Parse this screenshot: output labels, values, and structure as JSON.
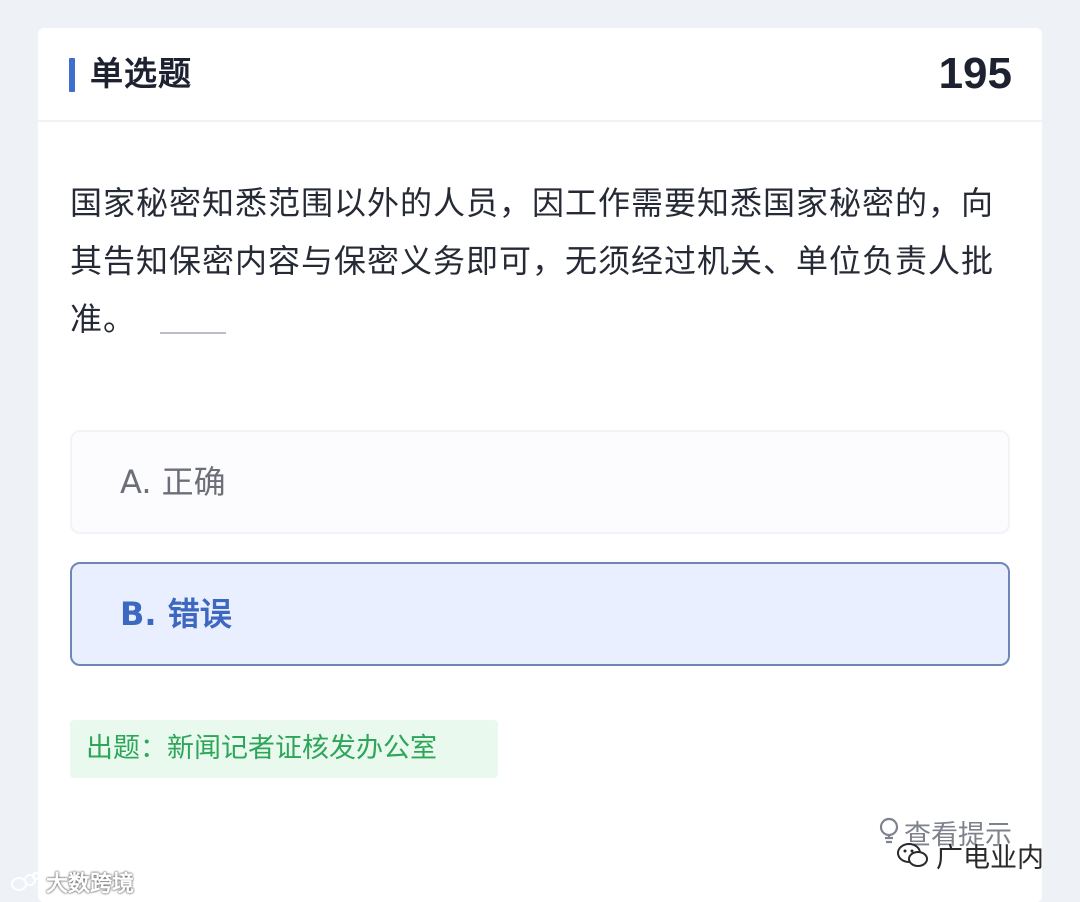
{
  "header": {
    "title": "单选题",
    "number": "195"
  },
  "question": {
    "text": "国家秘密知悉范围以外的人员，因工作需要知悉国家秘密的，向其告知保密内容与保密义务即可，无须经过机关、单位负责人批准。"
  },
  "options": [
    {
      "label": "A. 正确",
      "selected": false
    },
    {
      "label": "B. 错误",
      "selected": true
    }
  ],
  "source": {
    "text": "出题：新闻记者证核发办公室"
  },
  "hint": {
    "label": "查看提示",
    "icon": "lightbulb-icon"
  },
  "watermarks": {
    "left": "大数跨境",
    "right": "广电业内"
  },
  "colors": {
    "accent": "#3f6fcc",
    "selected_bg": "#e9efff",
    "selected_border": "#6f87b8",
    "source_green": "#2da65a"
  }
}
